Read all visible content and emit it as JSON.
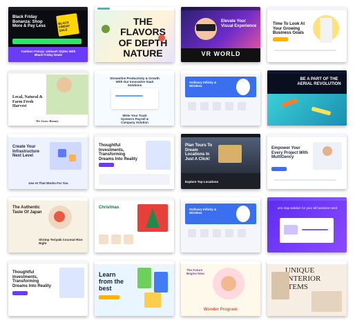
{
  "thumbnails": [
    {
      "id": "t1",
      "headline": "Black Friday Bonanza: Shop More & Pay Less",
      "badge": "BLACK FRIDAY SALE",
      "footer": "Fashion Frenzy: Unleash Styles With Black Friday Deals"
    },
    {
      "id": "t2",
      "headline": "THE FLAVORS OF DEPTH NATURE"
    },
    {
      "id": "t3",
      "headline": "Elevate Your Visual Experience",
      "footer": "VR WORLD"
    },
    {
      "id": "t4",
      "headline": "Time To Look At Your Growing Business Goals"
    },
    {
      "id": "t5",
      "headline": "Local, Natural & Farm Fresh Harvest",
      "footer": "We Grow Beauty"
    },
    {
      "id": "t6",
      "headline": "Streamline Productivity & Growth With Our Innovative SaaS Solutions",
      "footer": "Write Your Track System's Payroll & Company Solution"
    },
    {
      "id": "t7",
      "headline": "Ordinary Infinity & Wireless"
    },
    {
      "id": "t8",
      "headline": "BE A PART OF THE AERIAL REVOLUTION"
    },
    {
      "id": "t9",
      "headline": "Create Your Infrastructure Next Level",
      "footer": "Use AI That Works For You"
    },
    {
      "id": "t10",
      "headline": "Thoughtful Investments, Transforming Dreams Into Reality"
    },
    {
      "id": "t11",
      "headline": "Plan Tours To Dream Locations In Just A Click!",
      "footer": "Explore Top Locations"
    },
    {
      "id": "t12",
      "headline": "Empower Your Every Project With MultiGency"
    },
    {
      "id": "t13",
      "headline": "The Authentic Taste Of Japan",
      "footer": "Shrimp Teriyaki Coconut Rice Night"
    },
    {
      "id": "t14",
      "headline": "Christmas"
    },
    {
      "id": "t15",
      "headline": "Ordinary Infinity & Wireless"
    },
    {
      "id": "t16",
      "headline": "one stop solution for your all business need"
    },
    {
      "id": "t17",
      "headline": "Thoughtful Investments, Transforming Dreams Into Reality"
    },
    {
      "id": "t18",
      "headline": "Learn from the best"
    },
    {
      "id": "t19",
      "headline": "The Future Begins Now",
      "footer": "Wonder Program"
    },
    {
      "id": "t20",
      "headline": "UNIQUE INTERIOR ITEMS"
    }
  ],
  "colors": {
    "purple": "#6a3cf5",
    "black": "#111111",
    "yellow": "#ffd600",
    "mint": "#e9f7ee",
    "orange": "#f39a32",
    "blue": "#2b6cf6",
    "navy": "#0f1530",
    "cream": "#f7f1e4",
    "pink": "#ffd9e0"
  }
}
